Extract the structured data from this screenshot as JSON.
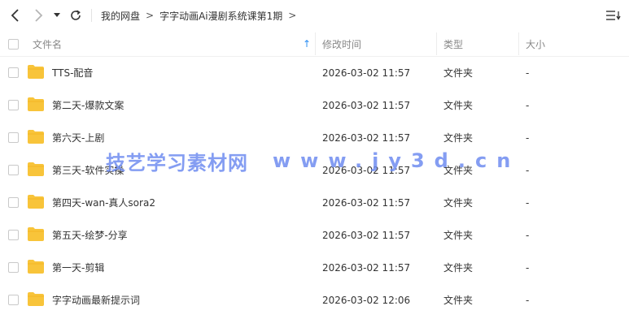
{
  "toolbar": {
    "breadcrumb": [
      "我的网盘",
      "字字动画Ai漫剧系统课第1期"
    ]
  },
  "columns": {
    "name": "文件名",
    "modified": "修改时间",
    "type": "类型",
    "size": "大小"
  },
  "files": [
    {
      "name": "TTS-配音",
      "modified": "2026-03-02 11:57",
      "type": "文件夹",
      "size": "-"
    },
    {
      "name": "第二天-爆款文案",
      "modified": "2026-03-02 11:57",
      "type": "文件夹",
      "size": "-"
    },
    {
      "name": "第六天-上剧",
      "modified": "2026-03-02 11:57",
      "type": "文件夹",
      "size": "-"
    },
    {
      "name": "第三天-软件实操",
      "modified": "2026-03-02 11:57",
      "type": "文件夹",
      "size": "-"
    },
    {
      "name": "第四天-wan-真人sora2",
      "modified": "2026-03-02 11:57",
      "type": "文件夹",
      "size": "-"
    },
    {
      "name": "第五天-绘梦-分享",
      "modified": "2026-03-02 11:57",
      "type": "文件夹",
      "size": "-"
    },
    {
      "name": "第一天-剪辑",
      "modified": "2026-03-02 11:57",
      "type": "文件夹",
      "size": "-"
    },
    {
      "name": "字字动画最新提示词",
      "modified": "2026-03-02 12:06",
      "type": "文件夹",
      "size": "-"
    }
  ],
  "watermark": {
    "text": "技艺学习素材网",
    "url": "www.jy3d.cn"
  },
  "colors": {
    "folder": "#f8c43a",
    "accent": "#2b8ef3",
    "watermark": "#6f8cf0"
  }
}
